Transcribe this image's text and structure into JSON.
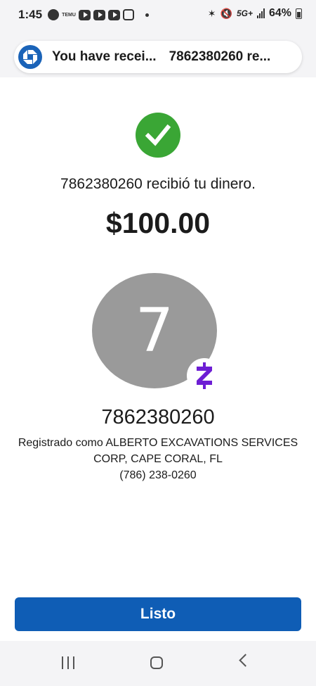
{
  "status_bar": {
    "time": "1:45",
    "network": "5G+",
    "battery": "64%",
    "app_icons": [
      "chase-icon",
      "temu-icon",
      "youtube-icon",
      "youtube-icon",
      "youtube-icon",
      "instagram-icon"
    ],
    "temu_label": "TEMU"
  },
  "notification": {
    "title": "You have recei...",
    "body": "7862380260 re..."
  },
  "confirmation": {
    "message": "7862380260 recibió tu dinero.",
    "amount": "$100.00",
    "avatar_letter": "7",
    "recipient_name": "7862380260",
    "registered_line1": "Registrado como ALBERTO EXCAVATIONS SERVICES",
    "registered_line2": "CORP, CAPE CORAL, FL",
    "phone": "(786) 238-0260"
  },
  "buttons": {
    "done_label": "Listo"
  },
  "colors": {
    "success_green": "#3aa635",
    "chase_blue": "#1a63b8",
    "button_blue": "#0f5db5",
    "zelle_purple": "#6d1ed4",
    "avatar_gray": "#9a9a9a"
  }
}
